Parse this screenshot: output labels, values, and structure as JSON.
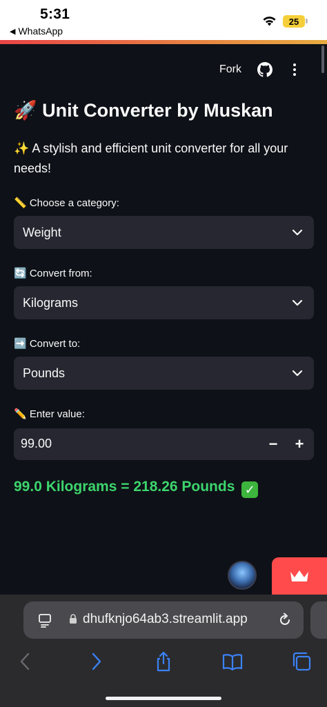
{
  "status_bar": {
    "time": "5:31",
    "back_app": "WhatsApp",
    "battery": "25"
  },
  "header": {
    "fork_label": "Fork",
    "github_icon": "github-icon",
    "menu_icon": "more-vertical-icon"
  },
  "main": {
    "title": "🚀 Unit Converter by Muskan",
    "subtitle": "✨ A stylish and efficient unit converter for all your needs!",
    "category": {
      "label": "📏 Choose a category:",
      "value": "Weight"
    },
    "from": {
      "label": "🔄 Convert from:",
      "value": "Kilograms"
    },
    "to": {
      "label": "➡️ Convert to:",
      "value": "Pounds"
    },
    "input": {
      "label": "✏️ Enter value:",
      "value": "99.00",
      "minus": "−",
      "plus": "+"
    },
    "result": "99.0 Kilograms = 218.26 Pounds",
    "result_check": "✓"
  },
  "safari": {
    "url": "dhufknjo64ab3.streamlit.app"
  },
  "colors": {
    "background": "#0e1117",
    "input_bg": "#262730",
    "result_green": "#3dd56d",
    "accent_red": "#ff4b4b",
    "safari_bg": "#2b2b2e"
  }
}
